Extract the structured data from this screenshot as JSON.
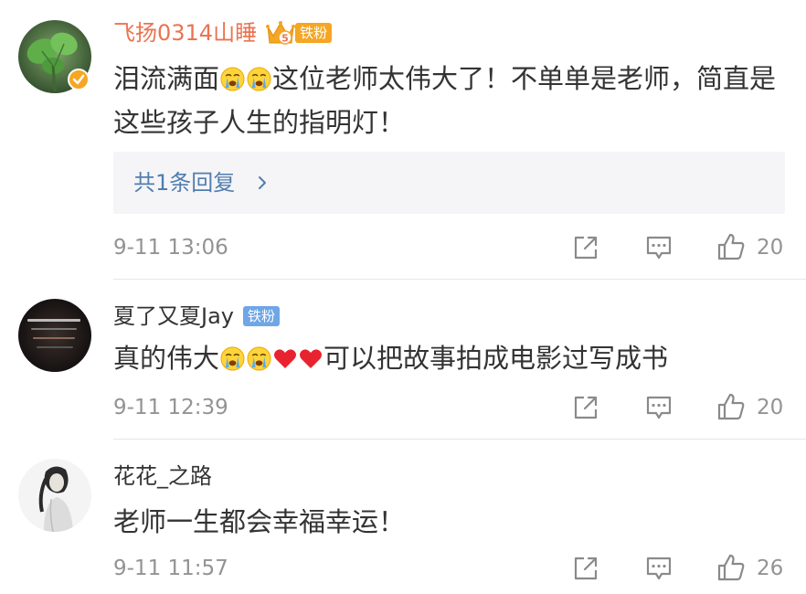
{
  "comments": [
    {
      "username": "飞扬0314山睡",
      "vip_level": "5",
      "badge": "铁粉",
      "text_before": "泪流满面",
      "text_after": "这位老师太伟大了！不单单是老师，简直是这些孩子人生的指明灯！",
      "reply": {
        "label": "共1条回复"
      },
      "time": "9-11 13:06",
      "likes": "20"
    },
    {
      "username": "夏了又夏Jay",
      "badge": "铁粉",
      "text_before": "真的伟大",
      "text_after": "可以把故事拍成电影过写成书",
      "time": "9-11 12:39",
      "likes": "20"
    },
    {
      "username": "花花_之路",
      "text": "老师一生都会幸福幸运！",
      "time": "9-11 11:57",
      "likes": "26"
    }
  ],
  "colors": {
    "vip_name": "#eb7350",
    "link": "#507daf",
    "fan_badge": "#6ea6e6",
    "gold_badge": "#f5a623",
    "meta_gray": "#939393"
  },
  "icons": {
    "share": "share-icon",
    "reply": "comment-icon",
    "like": "thumbs-up-icon",
    "verified": "verified-badge-icon"
  }
}
